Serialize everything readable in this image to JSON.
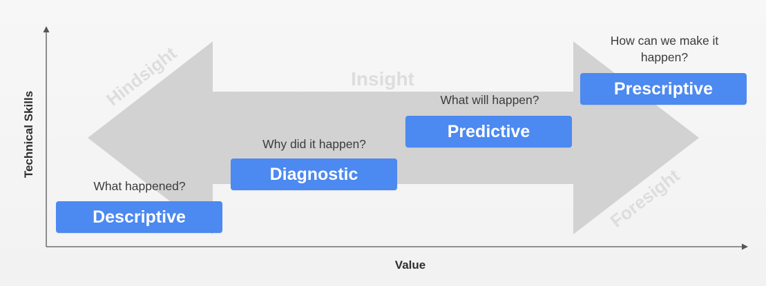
{
  "axes": {
    "y_label": "Technical Skills",
    "x_label": "Value"
  },
  "arrow": {
    "left_label": "Hindsight",
    "center_label": "Insight",
    "right_label": "Foresight",
    "color": "#d2d2d2"
  },
  "stages": [
    {
      "label": "Descriptive",
      "question": "What happened?"
    },
    {
      "label": "Diagnostic",
      "question": "Why did it happen?"
    },
    {
      "label": "Predictive",
      "question": "What will happen?"
    },
    {
      "label": "Prescriptive",
      "question": "How can we make it happen?"
    }
  ],
  "colors": {
    "stage_box": "#4c89f0",
    "axis_line": "#555555"
  }
}
